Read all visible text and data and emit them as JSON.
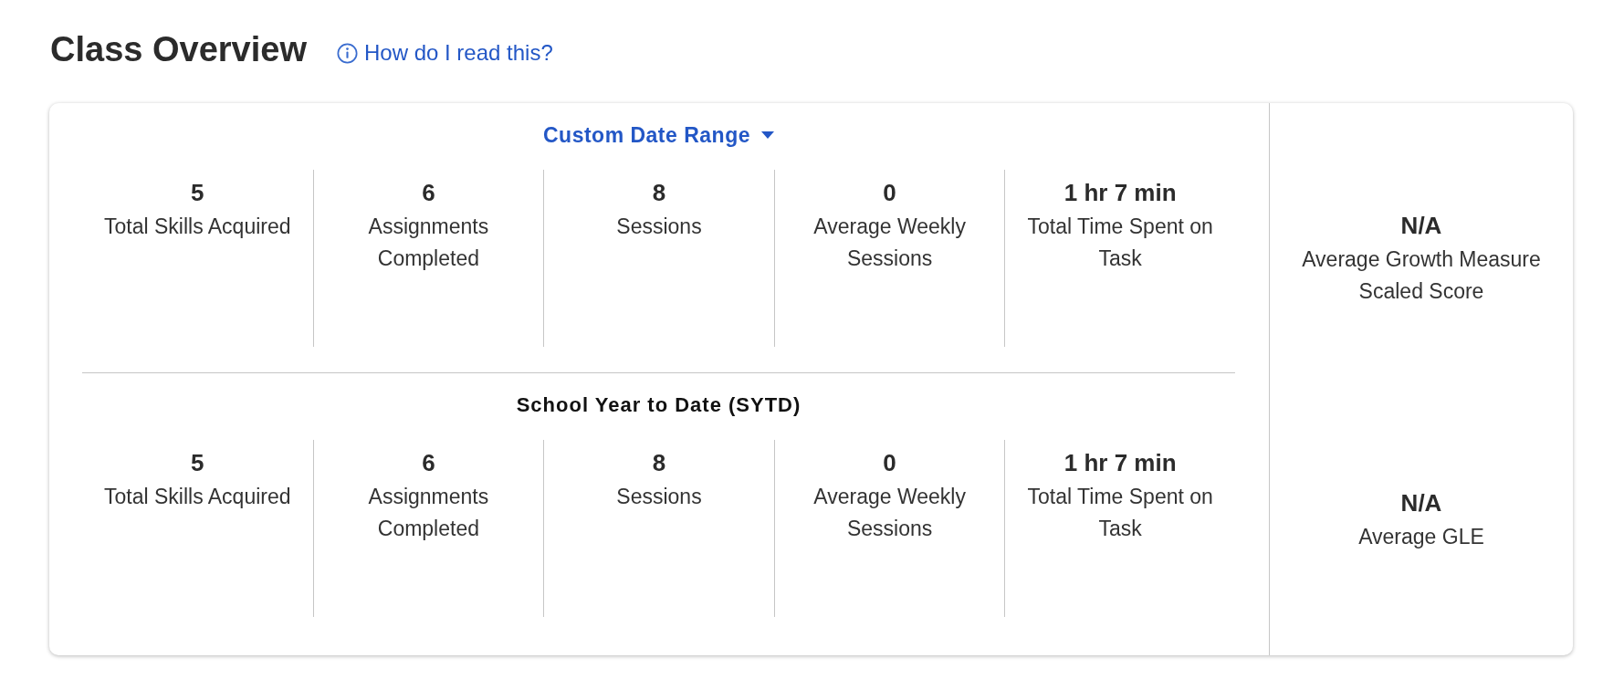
{
  "header": {
    "title": "Class Overview",
    "help_link": "How do I read this?"
  },
  "sections": [
    {
      "heading": {
        "kind": "dropdown",
        "text": "Custom Date Range"
      },
      "stats": [
        {
          "value": "5",
          "label": "Total Skills Acquired"
        },
        {
          "value": "6",
          "label": "Assignments Completed"
        },
        {
          "value": "8",
          "label": "Sessions"
        },
        {
          "value": "0",
          "label": "Average Weekly Sessions"
        },
        {
          "value": "1 hr 7 min",
          "label": "Total Time Spent on Task"
        }
      ]
    },
    {
      "heading": {
        "kind": "label",
        "text": "School Year to Date (SYTD)"
      },
      "stats": [
        {
          "value": "5",
          "label": "Total Skills Acquired"
        },
        {
          "value": "6",
          "label": "Assignments Completed"
        },
        {
          "value": "8",
          "label": "Sessions"
        },
        {
          "value": "0",
          "label": "Average Weekly Sessions"
        },
        {
          "value": "1 hr 7 min",
          "label": "Total Time Spent on Task"
        }
      ]
    }
  ],
  "scores": [
    {
      "value": "N/A",
      "label": "Average Growth Measure Scaled Score"
    },
    {
      "value": "N/A",
      "label": "Average GLE"
    }
  ]
}
